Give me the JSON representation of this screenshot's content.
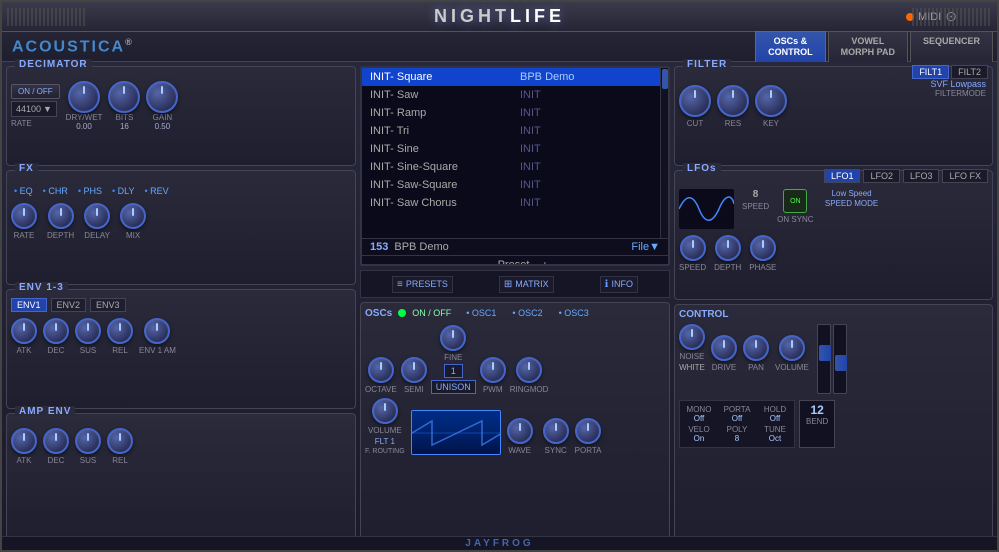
{
  "app": {
    "title_left": "NIGHT",
    "title_right": "LIFE",
    "brand": "ACOUSTICA",
    "brand_sup": "®",
    "midi_label": "MIDI",
    "jayfrog": "JAYFROG"
  },
  "tabs": {
    "oscs_control": "OSCs &\nCONTROL",
    "vowel_morph": "VOWEL\nMORPH PAD",
    "sequencer": "SEQUENCER"
  },
  "decimator": {
    "title": "DECIMATOR",
    "onoff": "ON / OFF",
    "rate_value": "44100",
    "rate_label": "RATE",
    "drywet_label": "DRY/WET",
    "drywet_value": "0.00",
    "bits_label": "BITS",
    "bits_value": "16",
    "gain_label": "GAIN",
    "gain_value": "0.50"
  },
  "fx": {
    "title": "FX",
    "tabs": [
      "EQ",
      "CHR",
      "PHS",
      "DLY",
      "REV"
    ],
    "knobs": [
      {
        "label": "RATE",
        "value": ""
      },
      {
        "label": "DEPTH",
        "value": ""
      },
      {
        "label": "DELAY",
        "value": ""
      },
      {
        "label": "MIX",
        "value": ""
      }
    ]
  },
  "env": {
    "title": "ENV 1-3",
    "tabs": [
      "ENV1",
      "ENV2",
      "ENV3"
    ],
    "knobs": [
      {
        "label": "ATK",
        "value": ""
      },
      {
        "label": "DEC",
        "value": ""
      },
      {
        "label": "SUS",
        "value": ""
      },
      {
        "label": "REL",
        "value": ""
      },
      {
        "label": "ENV 1 AM",
        "value": ""
      }
    ]
  },
  "amp_env": {
    "title": "AMP ENV",
    "knobs": [
      {
        "label": "ATK",
        "value": ""
      },
      {
        "label": "DEC",
        "value": ""
      },
      {
        "label": "SUS",
        "value": ""
      },
      {
        "label": "REL",
        "value": ""
      }
    ]
  },
  "presets": {
    "list": [
      {
        "name": "INIT- Square",
        "cat": ""
      },
      {
        "name": "INIT- Saw",
        "cat": ""
      },
      {
        "name": "INIT- Ramp",
        "cat": ""
      },
      {
        "name": "INIT- Tri",
        "cat": ""
      },
      {
        "name": "INIT- Sine",
        "cat": ""
      },
      {
        "name": "INIT- Sine-Square",
        "cat": ""
      },
      {
        "name": "INIT- Saw-Square",
        "cat": ""
      },
      {
        "name": "INIT- Saw Chorus",
        "cat": ""
      }
    ],
    "selected_index": 0,
    "selected_cat": "BPB Demo",
    "selected_init": "INIT",
    "preset_num": "153",
    "preset_name": "BPB Demo",
    "preset_label": "Preset",
    "file_label": "File▼",
    "nav_minus": "-",
    "nav_plus": "+",
    "btn_presets": "PRESETS",
    "btn_matrix": "MATRIX",
    "btn_info": "INFO"
  },
  "oscs": {
    "title": "OSCs",
    "onoff": "ON / OFF",
    "osc_tabs": [
      "OSC1",
      "OSC2",
      "OSC3"
    ],
    "knobs": [
      {
        "label": "OCTAVE",
        "value": ""
      },
      {
        "label": "SEMI",
        "value": ""
      },
      {
        "label": "FINE",
        "value": ""
      },
      {
        "label": "PWM",
        "value": ""
      },
      {
        "label": "RINGMOD",
        "value": ""
      }
    ],
    "voice_num": "1",
    "unison": "UNISON",
    "volume_label": "VOLUME",
    "flt1_label": "FLT 1",
    "frouting_label": "F. ROUTING",
    "wave_label": "WAVE",
    "sync_label": "SYNC"
  },
  "filter": {
    "title": "FILTER",
    "tabs": [
      "FILT1",
      "FILT2"
    ],
    "knobs": [
      {
        "label": "CUT",
        "value": ""
      },
      {
        "label": "RES",
        "value": ""
      },
      {
        "label": "KEY",
        "value": ""
      }
    ],
    "mode_label": "SVF Lowpass",
    "filtermode_label": "FILTERMODE"
  },
  "lfo": {
    "title": "LFOs",
    "tabs": [
      "LFO1",
      "LFO2",
      "LFO3",
      "LFO FX"
    ],
    "speed_val": "8",
    "speed_label": "SPEED",
    "sync_label": "ON\nSYNC",
    "speed_mode_label": "Low Speed\nSPEED MODE",
    "knobs": [
      {
        "label": "SPEED",
        "value": ""
      },
      {
        "label": "DEPTH",
        "value": ""
      },
      {
        "label": "PHASE",
        "value": ""
      }
    ]
  },
  "control": {
    "title": "CONTROL",
    "knobs": [
      {
        "label": "NOISE",
        "value": ""
      },
      {
        "label": "DRIVE",
        "value": ""
      },
      {
        "label": "PAN",
        "value": ""
      },
      {
        "label": "VOLUME",
        "value": ""
      }
    ],
    "noise_type": "WHITE",
    "porta_label": "PORTA",
    "mono_label": "MONO",
    "mono_val": "Off",
    "porta_val": "Off",
    "hold_label": "HOLD",
    "hold_val": "Off",
    "bend_label": "BEND",
    "bend_val": "12",
    "velo_label": "VELO",
    "velo_val": "On",
    "poly_label": "POLY",
    "poly_val": "8",
    "tune_label": "TUNE",
    "tune_val": "Oct"
  }
}
